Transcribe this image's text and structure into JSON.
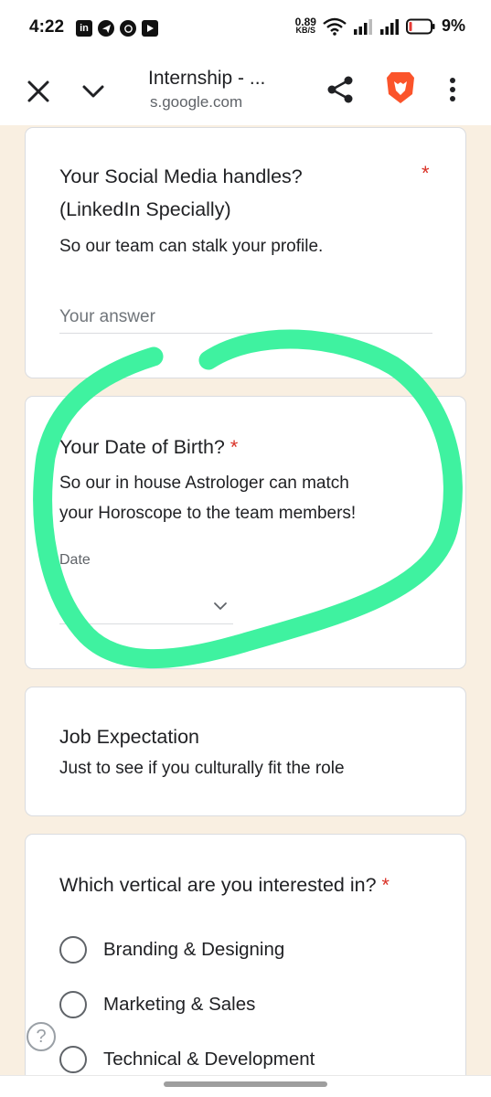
{
  "status_bar": {
    "time": "4:22",
    "net_speed_value": "0.89",
    "net_speed_unit": "KB/S",
    "battery_percent": "9%",
    "app_icons": [
      "linkedin-icon",
      "telegram-icon",
      "whatsapp-icon",
      "youtube-icon"
    ]
  },
  "browser": {
    "page_title": "Internship - ...",
    "domain": "s.google.com"
  },
  "form": {
    "q_social": {
      "title_line1": "Your Social Media handles?",
      "title_line2": "(LinkedIn Specially)",
      "required": "*",
      "description": "So our team can stalk your profile.",
      "placeholder": "Your answer"
    },
    "q_dob": {
      "title": "Your Date of Birth?",
      "required": "*",
      "description_line1": "So our in house Astrologer can match",
      "description_line2": "your Horoscope to the team members!",
      "date_label": "Date"
    },
    "section_job": {
      "title": "Job Expectation",
      "description": "Just to see if you culturally fit the role"
    },
    "q_vertical": {
      "title": "Which vertical are you interested in?",
      "required": "*",
      "options": [
        "Branding & Designing",
        "Marketing & Sales",
        "Technical & Development"
      ]
    }
  },
  "help": {
    "symbol": "?"
  },
  "colors": {
    "page_background": "#f9efe1",
    "required": "#d93025",
    "annotation_stroke": "#3ff2a0",
    "brave_orange": "#fb542b"
  }
}
